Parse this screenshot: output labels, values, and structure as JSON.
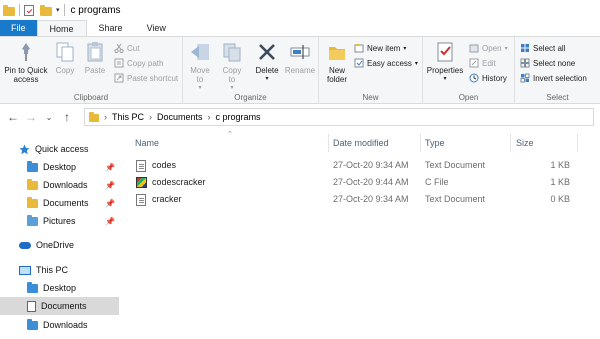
{
  "window": {
    "title": "c programs"
  },
  "tabs": [
    "File",
    "Home",
    "Share",
    "View"
  ],
  "ribbon": {
    "clipboard": {
      "label": "Clipboard",
      "pin": "Pin to Quick access",
      "copy": "Copy",
      "paste": "Paste",
      "cut": "Cut",
      "copy_path": "Copy path",
      "paste_shortcut": "Paste shortcut"
    },
    "organize": {
      "label": "Organize",
      "move_to": "Move to",
      "copy_to": "Copy to",
      "delete": "Delete",
      "rename": "Rename"
    },
    "new": {
      "label": "New",
      "new_folder": "New folder",
      "new_item": "New item",
      "easy_access": "Easy access"
    },
    "open": {
      "label": "Open",
      "properties": "Properties",
      "open": "Open",
      "edit": "Edit",
      "history": "History"
    },
    "select": {
      "label": "Select",
      "select_all": "Select all",
      "select_none": "Select none",
      "invert_selection": "Invert selection"
    }
  },
  "address": {
    "crumbs": [
      "This PC",
      "Documents",
      "c programs"
    ]
  },
  "sidebar": {
    "quick_access": "Quick access",
    "pinned": [
      "Desktop",
      "Downloads",
      "Documents",
      "Pictures"
    ],
    "onedrive": "OneDrive",
    "this_pc": "This PC",
    "pc_items": [
      "Desktop",
      "Documents",
      "Downloads"
    ]
  },
  "columns": {
    "name": "Name",
    "date": "Date modified",
    "type": "Type",
    "size": "Size"
  },
  "files": [
    {
      "name": "codes",
      "date": "27-Oct-20 9:34 AM",
      "type": "Text Document",
      "size": "1 KB",
      "icon": "text-file-icon"
    },
    {
      "name": "codescracker",
      "date": "27-Oct-20 9:44 AM",
      "type": "C File",
      "size": "1 KB",
      "icon": "c-file-icon"
    },
    {
      "name": "cracker",
      "date": "27-Oct-20 9:34 AM",
      "type": "Text Document",
      "size": "0 KB",
      "icon": "text-file-icon"
    }
  ],
  "colors": {
    "file_tab": "#1979ca",
    "selected_nav": "#d9d9d9",
    "header_text": "#4c607a"
  }
}
